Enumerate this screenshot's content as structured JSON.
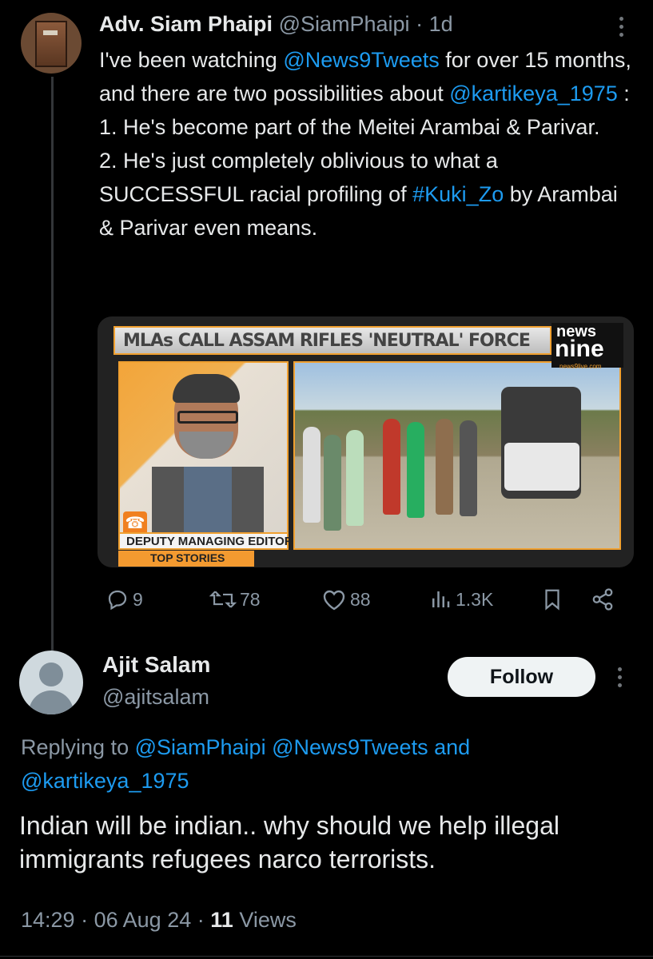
{
  "tweet": {
    "author_name": "Adv. Siam Phaipi",
    "author_handle": "@SiamPhaipi",
    "time_sep": "·",
    "time": "1d",
    "text": {
      "p1_a": "I've been watching ",
      "p1_link": "@News9Tweets",
      "p1_b": " for over 15 months, and there are two possibilities about ",
      "p1_link2": "@kartikeya_1975",
      "p1_c": " :",
      "p2": "1. He's become part of the Meitei Arambai & Parivar.",
      "p3_a": "2. He's just completely oblivious to what a SUCCESSFUL racial profiling of ",
      "p3_link": "#Kuki_Zo",
      "p3_b": " by Arambai & Parivar even means."
    },
    "media": {
      "banner": "MLAs CALL ASSAM RIFLES 'NEUTRAL' FORCE",
      "logo_top": "news",
      "logo_main": "nine",
      "logo_url": "news9live.com",
      "caption": "DEPUTY MANAGING EDITOR",
      "section": "TOP STORIES"
    },
    "stats": {
      "replies": "9",
      "reposts": "78",
      "likes": "88",
      "views": "1.3K"
    }
  },
  "reply": {
    "author_name": "Ajit Salam",
    "author_handle": "@ajitsalam",
    "follow_label": "Follow",
    "replying_prefix": "Replying to ",
    "replying_to_1": "@SiamPhaipi",
    "replying_to_2": "@News9Tweets",
    "replying_and": " and",
    "replying_to_3": "@kartikeya_1975",
    "text": "Indian will be indian.. why should we help illegal immigrants refugees narco terrorists.",
    "time": "14:29",
    "date": "06 Aug 24",
    "views_count": "11",
    "views_label": "Views",
    "sep": "·"
  },
  "icons": [
    "more-icon",
    "reply-icon",
    "repost-icon",
    "like-icon",
    "views-icon",
    "bookmark-icon",
    "share-icon"
  ],
  "colors": {
    "background": "#000000",
    "link": "#1d9bf0",
    "muted": "#8b98a5",
    "text": "#e7e9ea",
    "follow_bg": "#eff3f4"
  }
}
